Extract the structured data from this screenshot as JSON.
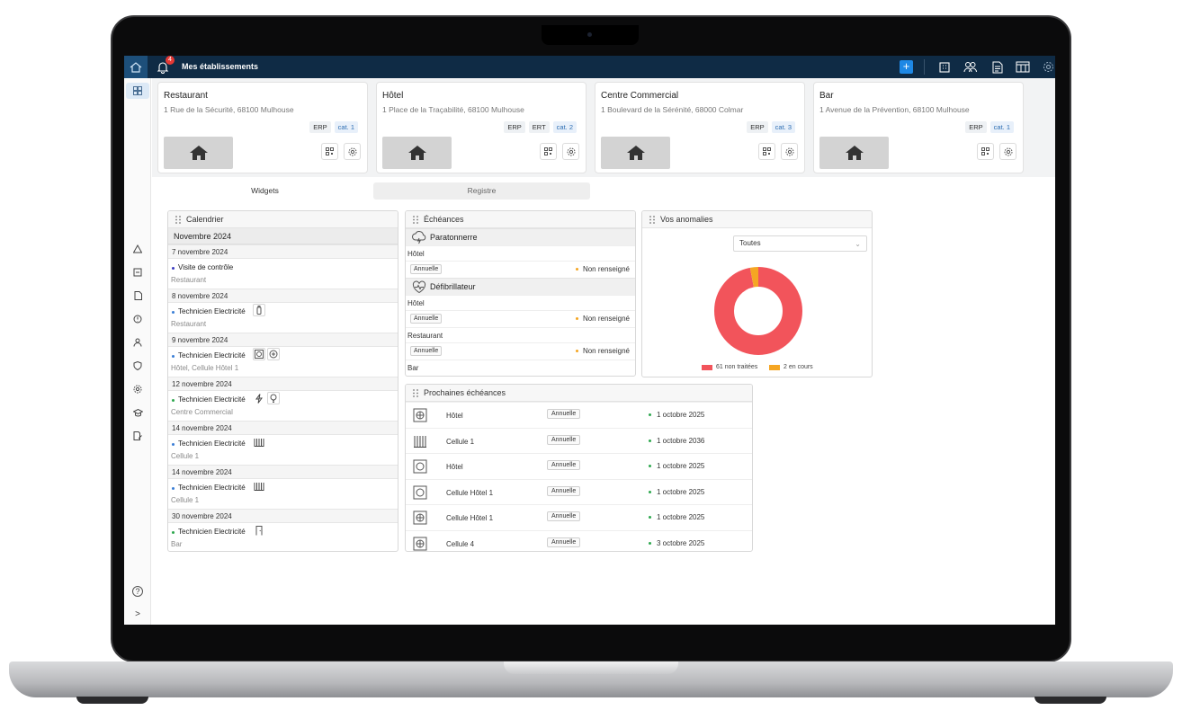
{
  "topbar": {
    "title": "Mes établissements",
    "notification_count": "4"
  },
  "establishments": [
    {
      "name": "Restaurant",
      "address": "1 Rue de la Sécurité, 68100 Mulhouse",
      "tags": [
        "ERP"
      ],
      "category": "cat. 1"
    },
    {
      "name": "Hôtel",
      "address": "1 Place de la Traçabilité, 68100 Mulhouse",
      "tags": [
        "ERP",
        "ERT"
      ],
      "category": "cat. 2"
    },
    {
      "name": "Centre Commercial",
      "address": "1 Boulevard de la Sérénité, 68000 Colmar",
      "tags": [
        "ERP"
      ],
      "category": "cat. 3"
    },
    {
      "name": "Bar",
      "address": "1 Avenue de la Prévention, 68100 Mulhouse",
      "tags": [
        "ERP"
      ],
      "category": "cat. 1"
    }
  ],
  "tabs": [
    {
      "label": "Widgets"
    },
    {
      "label": "Registre"
    }
  ],
  "calendar": {
    "title": "Calendrier",
    "month": "Novembre 2024",
    "days": [
      {
        "date": "7 novembre 2024",
        "event": "Visite de contrôle",
        "location": "Restaurant"
      },
      {
        "date": "8 novembre 2024",
        "event": "Technicien Electricité",
        "location": "Restaurant"
      },
      {
        "date": "9 novembre 2024",
        "event": "Technicien Electricité",
        "location": "Hôtel, Cellule Hôtel 1"
      },
      {
        "date": "12 novembre 2024",
        "event": "Technicien Electricité",
        "location": "Centre Commercial"
      },
      {
        "date": "14 novembre 2024",
        "event": "Technicien Electricité",
        "location": "Cellule 1"
      },
      {
        "date": "14 novembre 2024",
        "event": "Technicien Electricité",
        "location": "Cellule 1"
      },
      {
        "date": "30 novembre 2024",
        "event": "Technicien Electricité",
        "location": "Bar"
      }
    ]
  },
  "echeances": {
    "title": "Échéances",
    "groups": [
      {
        "category": "Paratonnerre",
        "rows": [
          {
            "site": "Hôtel",
            "frequency": "Annuelle",
            "status": "Non renseigné"
          }
        ]
      },
      {
        "category": "Défibrillateur",
        "rows": [
          {
            "site": "Hôtel",
            "frequency": "Annuelle",
            "status": "Non renseigné"
          },
          {
            "site": "Restaurant",
            "frequency": "Annuelle",
            "status": "Non renseigné"
          }
        ]
      }
    ],
    "trailing_site": "Bar"
  },
  "anomalies": {
    "title": "Vos anomalies",
    "filter_value": "Toutes",
    "legend": [
      {
        "label": "61 non traitées",
        "color": "#f2545b"
      },
      {
        "label": "2 en cours",
        "color": "#f5a623"
      }
    ]
  },
  "chart_data": {
    "type": "pie",
    "categories": [
      "non traitées",
      "en cours"
    ],
    "values": [
      61,
      2
    ],
    "colors": [
      "#f2545b",
      "#f5a623"
    ]
  },
  "prochaines": {
    "title": "Prochaines échéances",
    "rows": [
      {
        "name": "Hôtel",
        "frequency": "Annuelle",
        "date": "1 octobre 2025"
      },
      {
        "name": "Cellule 1",
        "frequency": "Annuelle",
        "date": "1 octobre 2036"
      },
      {
        "name": "Hôtel",
        "frequency": "Annuelle",
        "date": "1 octobre 2025"
      },
      {
        "name": "Cellule Hôtel 1",
        "frequency": "Annuelle",
        "date": "1 octobre 2025"
      },
      {
        "name": "Cellule Hôtel 1",
        "frequency": "Annuelle",
        "date": "1 octobre 2025"
      },
      {
        "name": "Cellule 4",
        "frequency": "Annuelle",
        "date": "3 octobre 2025"
      }
    ]
  },
  "sidebar": {
    "help_label": "?",
    "expand_label": ">"
  }
}
